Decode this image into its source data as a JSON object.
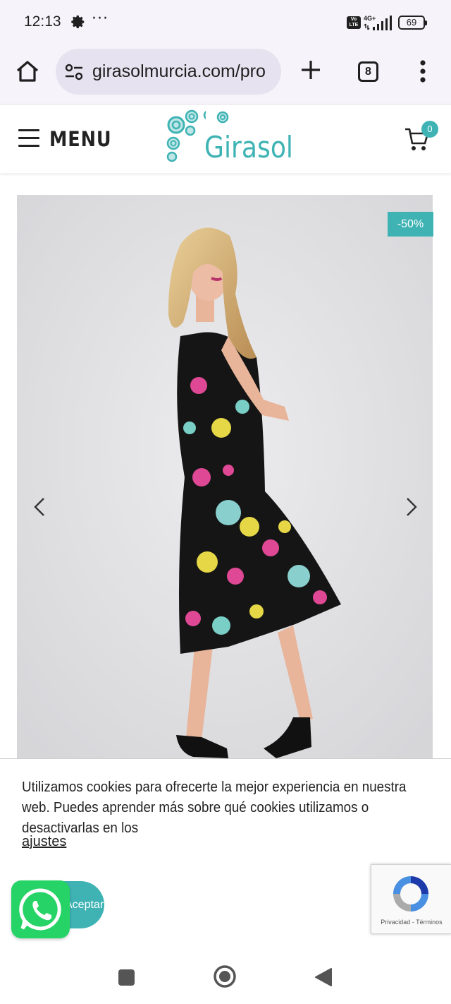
{
  "status_bar": {
    "time": "12:13",
    "dots": "···",
    "volte": "Vo LTE",
    "network": "4G+",
    "battery": "69"
  },
  "browser": {
    "url": "girasolmurcia.com/pro",
    "tabs_count": "8"
  },
  "site_header": {
    "menu_label": "MENU",
    "logo_text": "Girasol",
    "cart_count": "0",
    "accent_color": "#3fb3b4"
  },
  "product": {
    "image_alt": "Vestido estampado",
    "discount": "-50%"
  },
  "cookie_banner": {
    "text": "Utilizamos cookies para ofrecerte la mejor experiencia en nuestra web. Puedes aprender más sobre qué cookies utilizamos o desactivarlas en los",
    "link": "ajustes",
    "link_suffix": ".",
    "accept_label": "Aceptar"
  },
  "recaptcha": {
    "privacy": "Privacidad",
    "separator": " - ",
    "terms": "Términos"
  },
  "icons": {
    "whatsapp": "whatsapp-icon",
    "cart": "cart-icon",
    "home": "home-icon"
  }
}
